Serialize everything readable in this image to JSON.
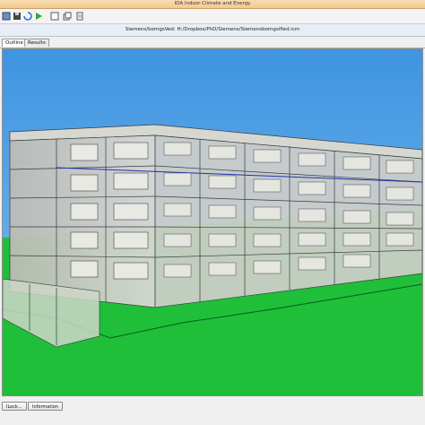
{
  "window": {
    "title": "IDA Indoor Climate and Energy"
  },
  "toolbar": {
    "buttons": [
      {
        "icon": "app-icon"
      },
      {
        "icon": "save-icon"
      },
      {
        "icon": "reload-icon"
      },
      {
        "icon": "run-icon"
      },
      {
        "icon": "checkbox-icon"
      },
      {
        "icon": "copy-icon"
      },
      {
        "icon": "page-icon"
      }
    ]
  },
  "path_bar": {
    "text": "Siemens/bomgsVed: H:/Dropbox/PhD/Siemens/Siemensbomgsified.icm"
  },
  "tabs": [
    {
      "label": "Outline"
    },
    {
      "label": "Results"
    }
  ],
  "viewport": {
    "description_colors": {
      "sky": "#4a9fe6",
      "ground": "#1fbf3a",
      "glass": "#c9c9c4"
    }
  },
  "bottom_bar": {
    "left_button": "ILock...",
    "right_button": "Information"
  }
}
